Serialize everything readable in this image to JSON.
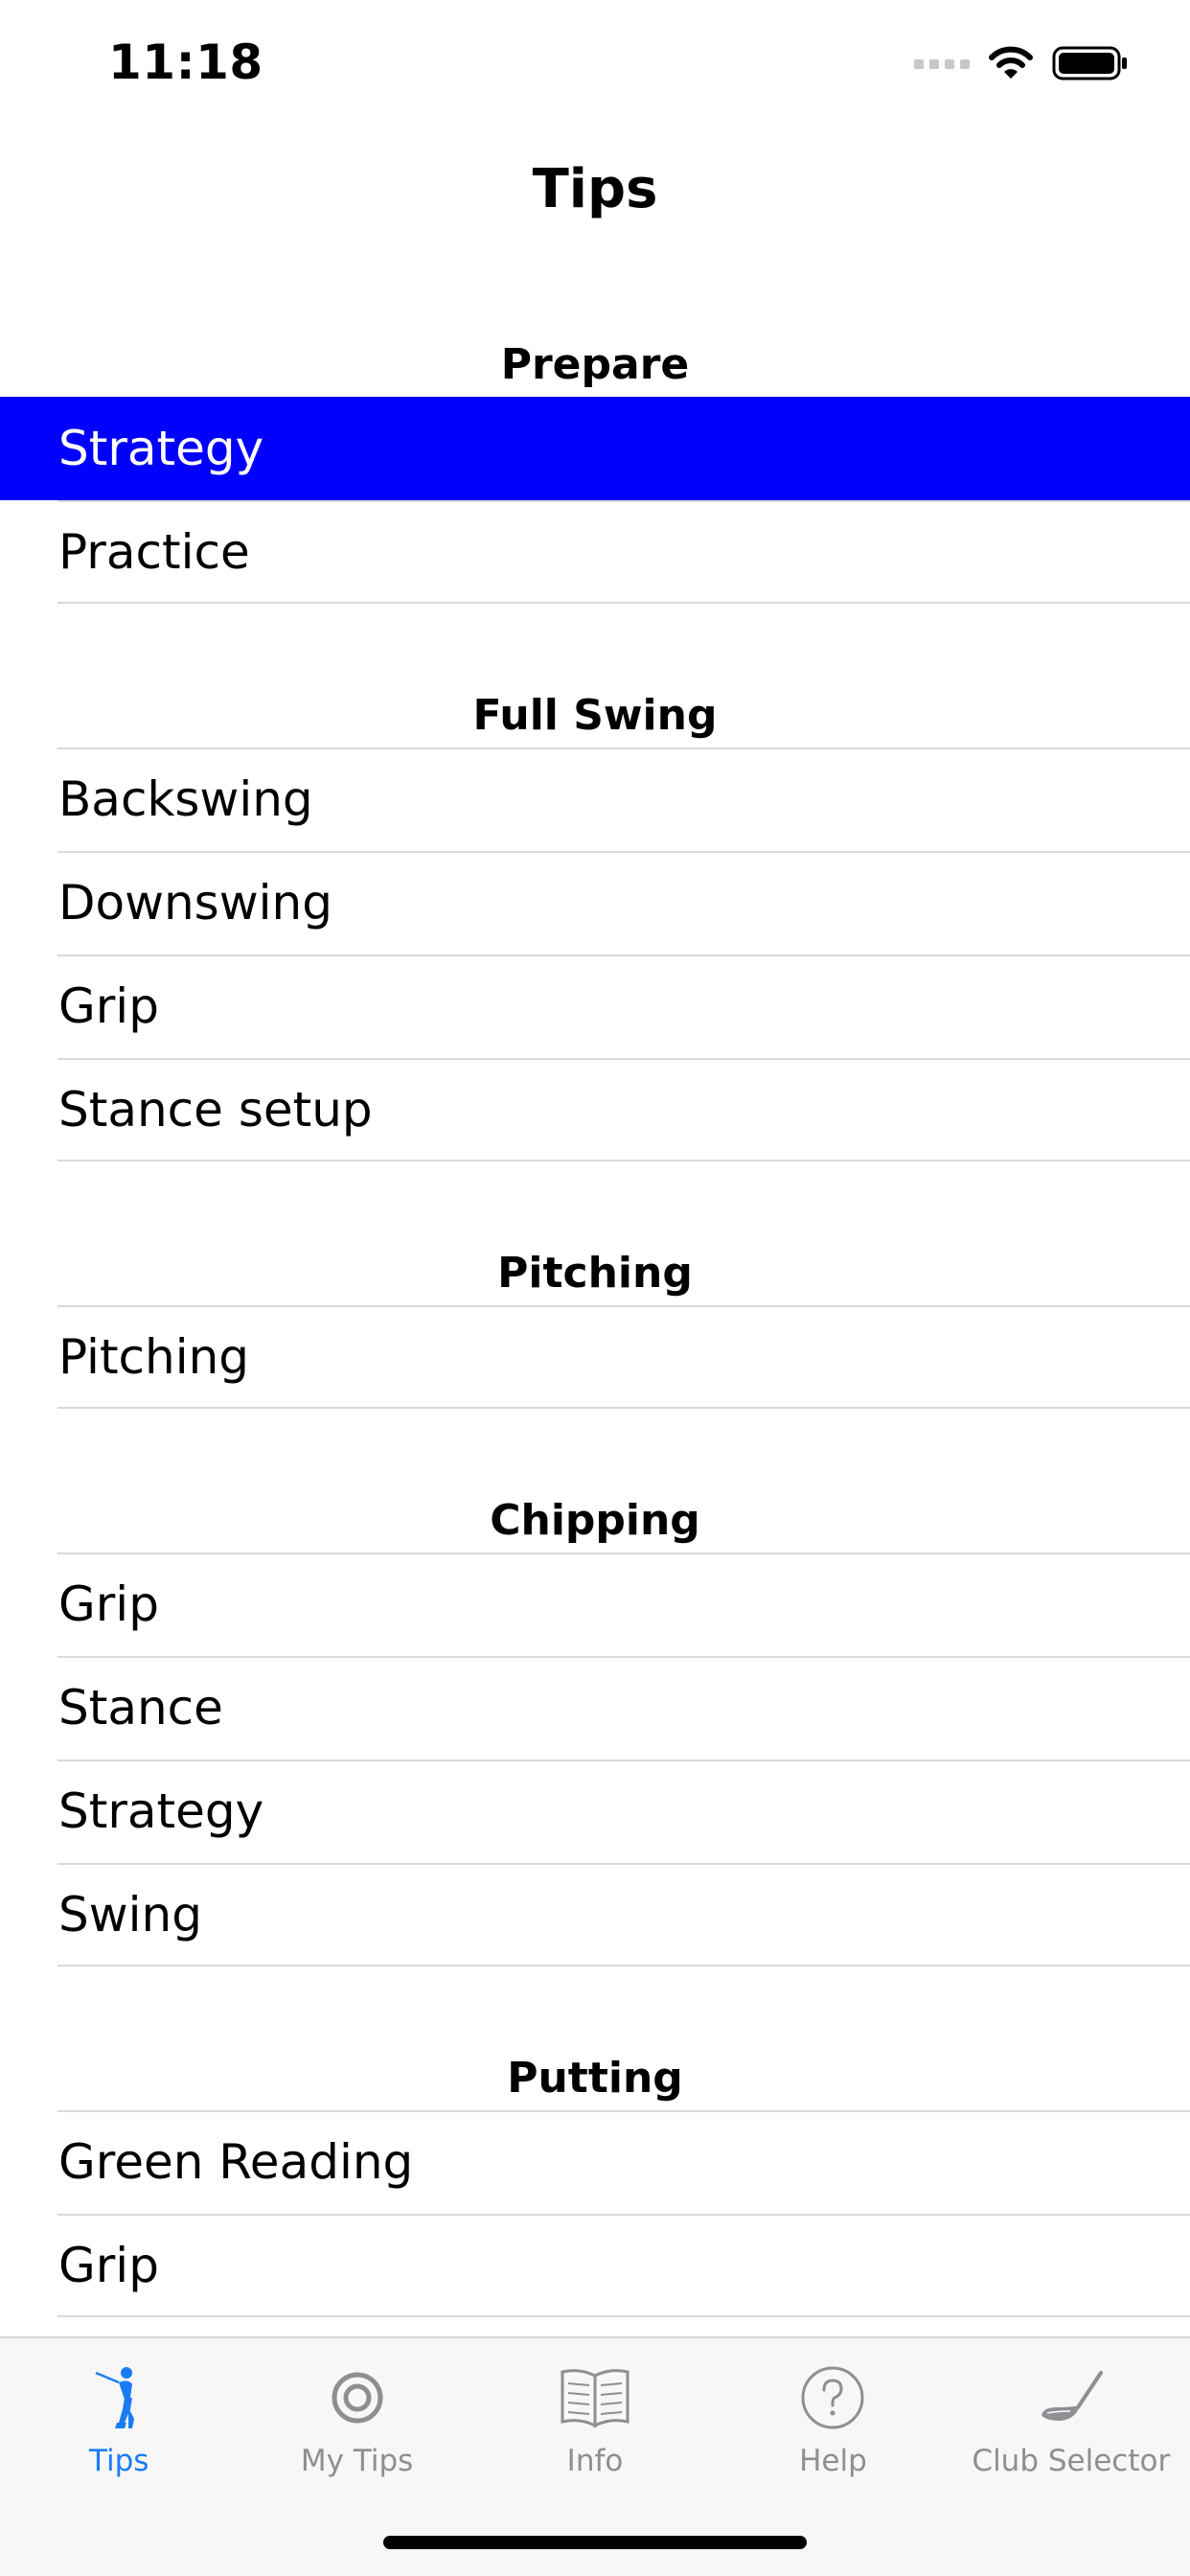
{
  "status": {
    "time": "11:18",
    "icons": [
      "signal-icon",
      "wifi-icon",
      "battery-icon"
    ]
  },
  "nav": {
    "title": "Tips"
  },
  "sections": [
    {
      "header": "Prepare",
      "items": [
        "Strategy",
        "Practice"
      ]
    },
    {
      "header": "Full Swing",
      "items": [
        "Backswing",
        "Downswing",
        "Grip",
        "Stance setup"
      ]
    },
    {
      "header": "Pitching",
      "items": [
        "Pitching"
      ]
    },
    {
      "header": "Chipping",
      "items": [
        "Grip",
        "Stance",
        "Strategy",
        "Swing"
      ]
    },
    {
      "header": "Putting",
      "items": [
        "Green Reading",
        "Grip"
      ]
    }
  ],
  "selected_color": "#0000ff",
  "tabs": [
    {
      "label": "Tips",
      "icon": "golfer-icon",
      "active": true
    },
    {
      "label": "My Tips",
      "icon": "target-icon",
      "active": false
    },
    {
      "label": "Info",
      "icon": "book-icon",
      "active": false
    },
    {
      "label": "Help",
      "icon": "help-icon",
      "active": false
    },
    {
      "label": "Club Selector",
      "icon": "golf-club-icon",
      "active": false
    }
  ],
  "colors": {
    "accent": "#1a7cf5",
    "inactive": "#8e8e93"
  }
}
